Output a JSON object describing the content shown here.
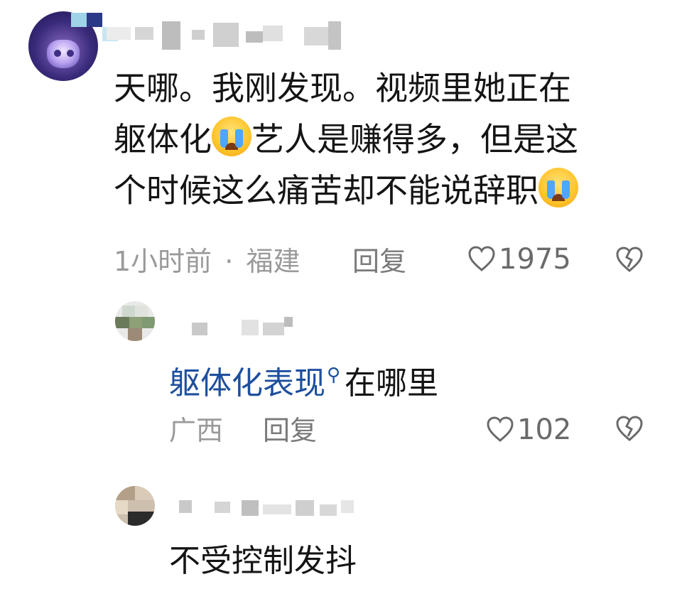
{
  "main_comment": {
    "lines": [
      "天哪。我刚发现。视频里她正在",
      "躯体化",
      "艺人是赚得多，但是这",
      "个时候这么痛苦却不能说辞职"
    ],
    "emoji_name": "loudly-crying-face",
    "time": "1小时前",
    "separator": "·",
    "location": "福建",
    "reply_label": "回复",
    "like_count": "1975"
  },
  "replies": [
    {
      "link_text": "躯体化表现",
      "text": "在哪里",
      "location": "广西",
      "reply_label": "回复",
      "like_count": "102"
    },
    {
      "text": "不受控制发抖"
    }
  ],
  "icons": {
    "like": "heart-outline-icon",
    "dislike": "broken-heart-icon",
    "search": "search-icon"
  },
  "colors": {
    "link": "#1e4f9e",
    "meta": "#9a9a9a"
  }
}
